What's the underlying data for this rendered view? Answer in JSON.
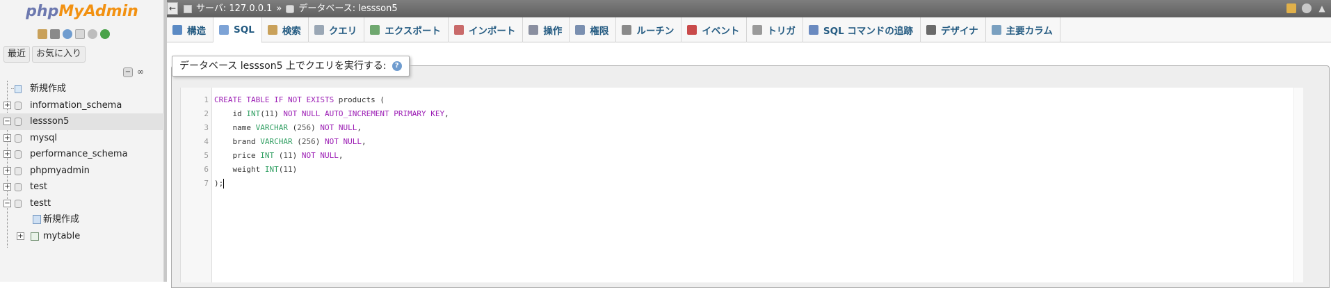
{
  "nav": {
    "logo_php": "php",
    "logo_myadmin": "MyAdmin",
    "buttons": [
      "最近",
      "お気に入り"
    ],
    "collapse_label": "−",
    "link_label": "∞",
    "tree": [
      {
        "label": "新規作成"
      },
      {
        "label": "information_schema"
      },
      {
        "label": "lessson5",
        "selected": true
      },
      {
        "label": "mysql"
      },
      {
        "label": "performance_schema"
      },
      {
        "label": "phpmyadmin"
      },
      {
        "label": "test"
      },
      {
        "label": "testt"
      },
      {
        "label": "新規作成"
      },
      {
        "label": "mytable"
      }
    ]
  },
  "topbar": {
    "back_label": "←",
    "server_label": "サーバ: 127.0.0.1",
    "separator": "»",
    "database_label": "データベース: lessson5"
  },
  "tabs": [
    {
      "label": "構造",
      "icon": "structure-icon",
      "color": "#5b8ac4"
    },
    {
      "label": "SQL",
      "icon": "sql-icon",
      "color": "#7da3d6",
      "active": true
    },
    {
      "label": "検索",
      "icon": "search-icon",
      "color": "#c9a15a"
    },
    {
      "label": "クエリ",
      "icon": "query-icon",
      "color": "#9aa7b5"
    },
    {
      "label": "エクスポート",
      "icon": "export-icon",
      "color": "#6fa86f"
    },
    {
      "label": "インポート",
      "icon": "import-icon",
      "color": "#c96a6a"
    },
    {
      "label": "操作",
      "icon": "wrench-icon",
      "color": "#8a8fa0"
    },
    {
      "label": "権限",
      "icon": "privileges-icon",
      "color": "#7a8fb0"
    },
    {
      "label": "ルーチン",
      "icon": "routines-icon",
      "color": "#8a8a8a"
    },
    {
      "label": "イベント",
      "icon": "events-icon",
      "color": "#c94a4a"
    },
    {
      "label": "トリガ",
      "icon": "triggers-icon",
      "color": "#9a9a9a"
    },
    {
      "label": "SQL コマンドの追跡",
      "icon": "tracking-icon",
      "color": "#6a8ac0"
    },
    {
      "label": "デザイナ",
      "icon": "designer-icon",
      "color": "#6a6a6a"
    },
    {
      "label": "主要カラム",
      "icon": "central-columns-icon",
      "color": "#7aa0c0"
    }
  ],
  "query_panel": {
    "legend": "データベース lessson5 上でクエリを実行する:",
    "help": "?"
  },
  "editor": {
    "line_numbers": [
      "1",
      "2",
      "3",
      "4",
      "5",
      "6",
      "7"
    ],
    "lines": [
      [
        [
          "kw",
          "CREATE TABLE IF NOT EXISTS"
        ],
        [
          "pl",
          " products ("
        ]
      ],
      [
        [
          "pl",
          "    id "
        ],
        [
          "ty",
          "INT"
        ],
        [
          "pl",
          "("
        ],
        [
          "nm",
          "11"
        ],
        [
          "pl",
          ") "
        ],
        [
          "kw",
          "NOT NULL AUTO_INCREMENT PRIMARY KEY"
        ],
        [
          "pl",
          ","
        ]
      ],
      [
        [
          "pl",
          "    name "
        ],
        [
          "ty",
          "VARCHAR"
        ],
        [
          "pl",
          " ("
        ],
        [
          "nm",
          "256"
        ],
        [
          "pl",
          ") "
        ],
        [
          "kw",
          "NOT NULL"
        ],
        [
          "pl",
          ","
        ]
      ],
      [
        [
          "pl",
          "    brand "
        ],
        [
          "ty",
          "VARCHAR"
        ],
        [
          "pl",
          " ("
        ],
        [
          "nm",
          "256"
        ],
        [
          "pl",
          ") "
        ],
        [
          "kw",
          "NOT NULL"
        ],
        [
          "pl",
          ","
        ]
      ],
      [
        [
          "pl",
          "    price "
        ],
        [
          "ty",
          "INT"
        ],
        [
          "pl",
          " ("
        ],
        [
          "nm",
          "11"
        ],
        [
          "pl",
          ") "
        ],
        [
          "kw",
          "NOT NULL"
        ],
        [
          "pl",
          ","
        ]
      ],
      [
        [
          "pl",
          "    weight "
        ],
        [
          "ty",
          "INT"
        ],
        [
          "pl",
          "("
        ],
        [
          "nm",
          "11"
        ],
        [
          "pl",
          ")"
        ]
      ],
      [
        [
          "pl",
          ");"
        ]
      ]
    ]
  }
}
